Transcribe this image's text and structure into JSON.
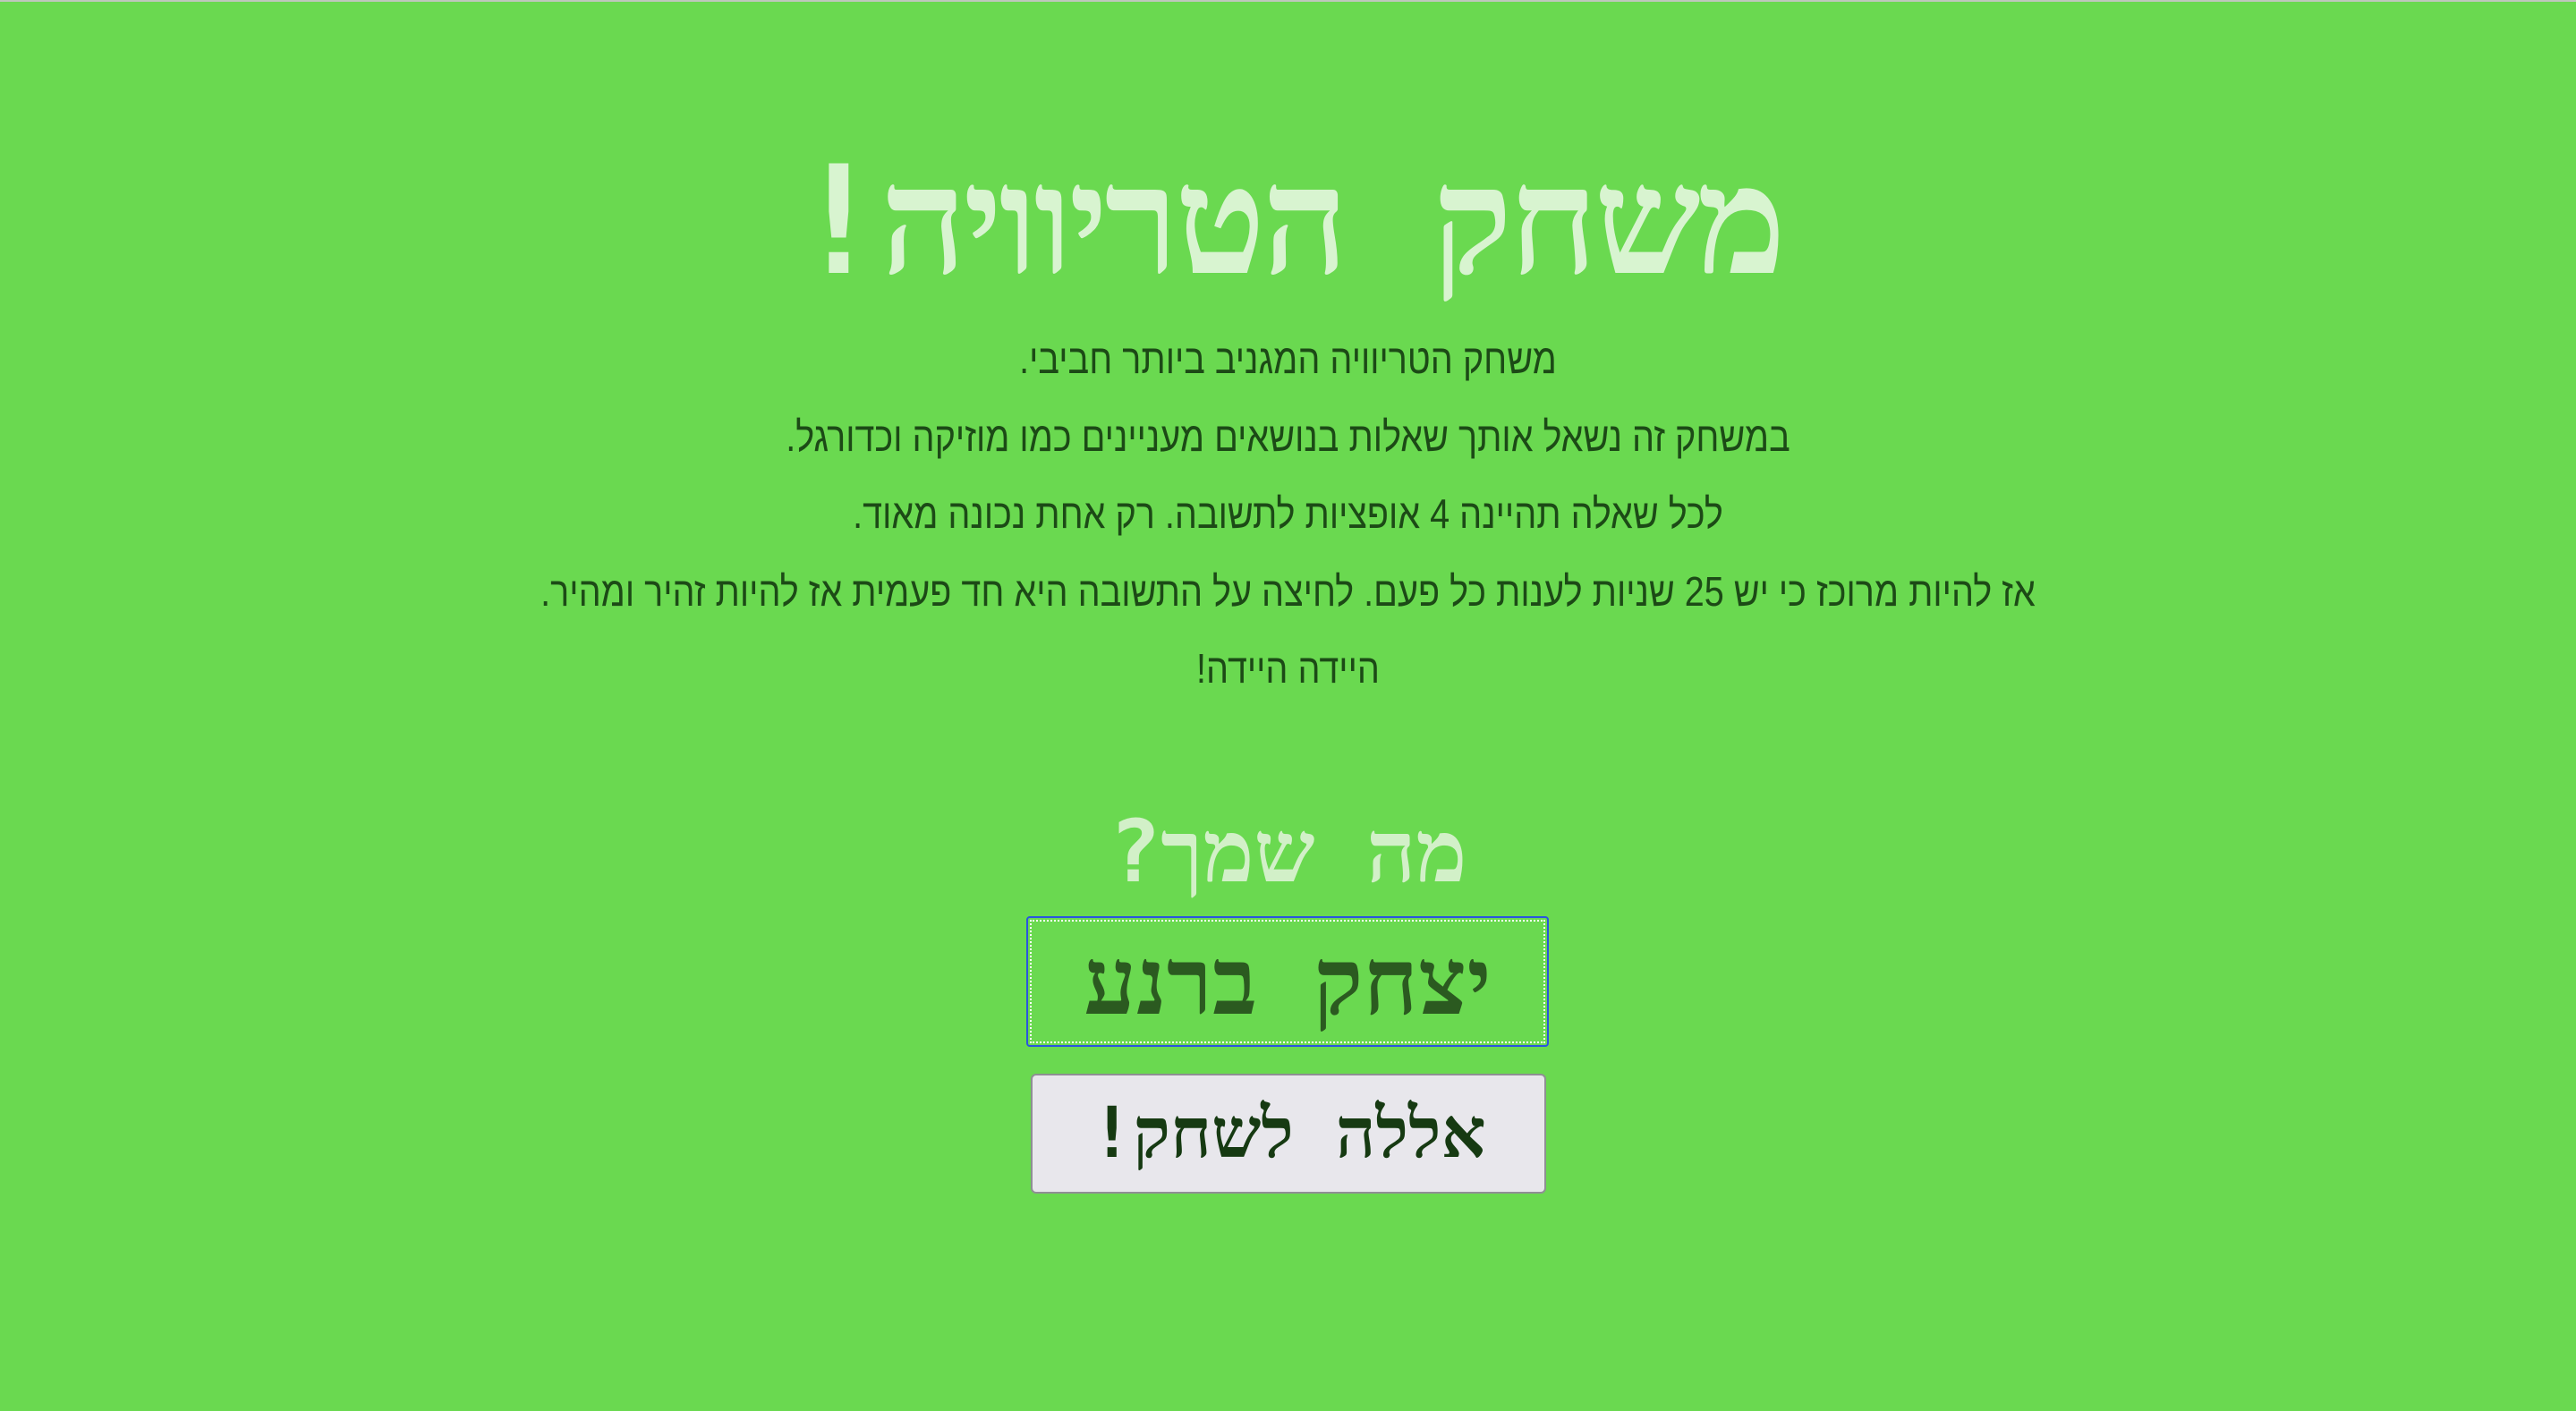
{
  "game": {
    "title": "משחק הטריוויה!",
    "intro_lines": [
      "משחק הטריוויה המגניב ביותר חביבי.",
      "במשחק זה נשאל אותך שאלות בנושאים מעניינים כמו מוזיקה וכדורגל.",
      "לכל שאלה תהיינה 4 אופציות לתשובה. רק אחת נכונה מאוד.",
      "אז להיות מרוכז כי יש 25 שניות לענות כל פעם. לחיצה על התשובה היא חד פעמית אז להיות זהיר ומהיר.",
      "היידה היידה!"
    ]
  },
  "name_form": {
    "prompt": "מה שמך?",
    "name_value": "יצחק ברנע",
    "play_label": "אללה לשחק!"
  },
  "colors": {
    "background": "#6ad950",
    "title": "#d8f4d0",
    "body_text": "#1c4a16",
    "input_focus_border": "#2a55e0",
    "button_background": "#e8e7ec"
  }
}
